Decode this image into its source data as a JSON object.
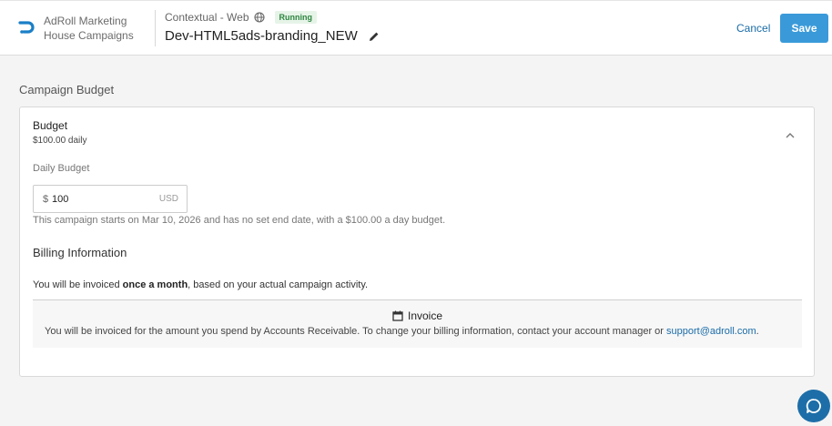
{
  "header": {
    "org_line1": "AdRoll Marketing",
    "org_line2": "House Campaigns",
    "breadcrumb": "Contextual - Web",
    "status": "Running",
    "campaign_name": "Dev-HTML5ads-branding_NEW",
    "cancel_label": "Cancel",
    "save_label": "Save"
  },
  "section_title": "Campaign Budget",
  "budget": {
    "heading": "Budget",
    "summary": "$100.00 daily",
    "daily_label": "Daily Budget",
    "currency_symbol": "$",
    "value": "100",
    "unit": "USD",
    "help_text": "This campaign starts on Mar 10, 2026 and has no set end date, with a $100.00 a day budget."
  },
  "billing": {
    "heading": "Billing Information",
    "text_prefix": "You will be invoiced ",
    "text_bold": "once a month",
    "text_suffix": ", based on your actual campaign activity.",
    "invoice_title": "Invoice",
    "invoice_text": "You will be invoiced for the amount you spend by Accounts Receivable. To change your billing information, contact your account manager or ",
    "support_link": "support@adroll.com",
    "invoice_end": "."
  },
  "colors": {
    "primary": "#3a9ad9",
    "link": "#1a6ca8",
    "status_bg": "#e6f4e8",
    "status_text": "#2e8540"
  },
  "icons": [
    "adroll-logo-icon",
    "globe-icon",
    "pencil-icon",
    "chevron-up-icon",
    "calendar-icon",
    "chat-icon"
  ]
}
